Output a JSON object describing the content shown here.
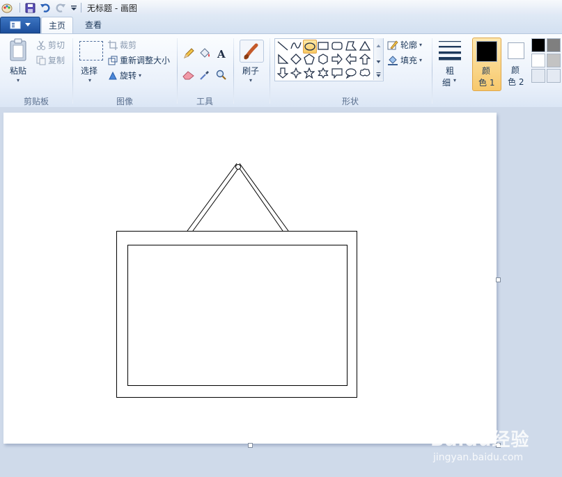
{
  "window": {
    "title": "无标题 - 画图"
  },
  "tabs": [
    {
      "label": "主页",
      "active": true
    },
    {
      "label": "查看",
      "active": false
    }
  ],
  "clipboard": {
    "paste_label": "粘贴",
    "cut_label": "剪切",
    "copy_label": "复制",
    "group_label": "剪贴板"
  },
  "image": {
    "select_label": "选择",
    "crop_label": "裁剪",
    "resize_label": "重新调整大小",
    "rotate_label": "旋转",
    "group_label": "图像"
  },
  "tools": {
    "group_label": "工具",
    "items": [
      "pencil-icon",
      "fill-icon",
      "text-icon",
      "eraser-icon",
      "color-picker-icon",
      "magnifier-icon"
    ]
  },
  "brushes": {
    "label": "刷子"
  },
  "shapes": {
    "group_label": "形状",
    "outline_label": "轮廓",
    "fill_label": "填充",
    "selected_shape": "oval"
  },
  "size": {
    "label_line1": "粗",
    "label_line2": "细"
  },
  "colors": {
    "color1_line1": "颜",
    "color1_line2": "色 1",
    "color2_line1": "颜",
    "color2_line2": "色 2",
    "color1_value": "#000000",
    "color2_value": "#ffffff",
    "palette": [
      "#000000",
      "#7f7f7f",
      "#ffffff",
      "#c3c3c3"
    ]
  },
  "watermark": {
    "brand": "Baidu经验",
    "url": "jingyan.baidu.com"
  }
}
